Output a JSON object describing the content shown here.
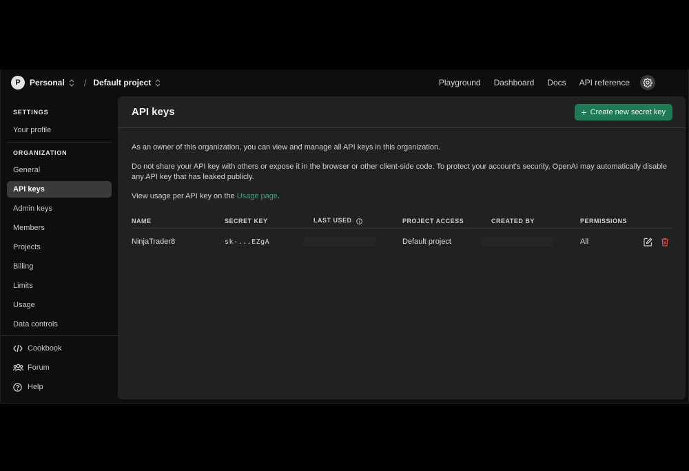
{
  "topbar": {
    "avatar_letter": "P",
    "org_name": "Personal",
    "separator": "/",
    "project_name": "Default project",
    "nav": [
      "Playground",
      "Dashboard",
      "Docs",
      "API reference"
    ]
  },
  "sidebar": {
    "settings_heading": "SETTINGS",
    "settings_items": [
      "Your profile"
    ],
    "org_heading": "ORGANIZATION",
    "org_items": [
      "General",
      "API keys",
      "Admin keys",
      "Members",
      "Projects",
      "Billing",
      "Limits",
      "Usage",
      "Data controls"
    ],
    "active_item": "API keys",
    "footer_items": [
      {
        "label": "Cookbook",
        "icon": "code-icon"
      },
      {
        "label": "Forum",
        "icon": "people-icon"
      },
      {
        "label": "Help",
        "icon": "help-icon"
      }
    ]
  },
  "main": {
    "title": "API keys",
    "create_button": "Create new secret key",
    "desc1": "As an owner of this organization, you can view and manage all API keys in this organization.",
    "desc2": "Do not share your API key with others or expose it in the browser or other client-side code. To protect your account's security, OpenAI may automatically disable any API key that has leaked publicly.",
    "desc3_prefix": "View usage per API key on the ",
    "desc3_link": "Usage page",
    "desc3_suffix": ".",
    "table": {
      "headers": [
        "NAME",
        "SECRET KEY",
        "LAST USED",
        "PROJECT ACCESS",
        "CREATED BY",
        "PERMISSIONS"
      ],
      "rows": [
        {
          "name": "NinjaTrader8",
          "secret_key": "sk-...EZgA",
          "project_access": "Default project",
          "permissions": "All"
        }
      ]
    }
  },
  "colors": {
    "accent_green": "#1f7a56",
    "link_green": "#3ca37a",
    "delete_red": "#e5484d"
  }
}
